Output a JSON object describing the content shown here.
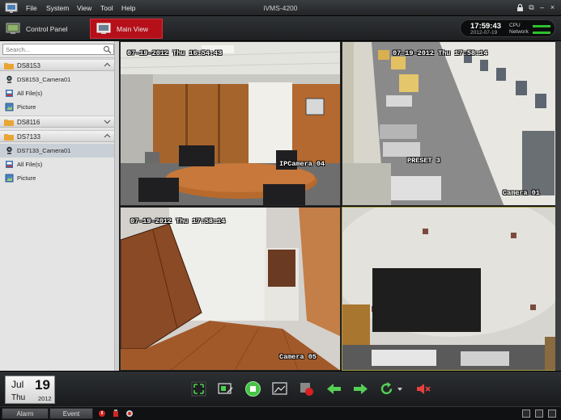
{
  "app": {
    "title": "iVMS-4200"
  },
  "menu": {
    "file": "File",
    "system": "System",
    "view": "View",
    "tool": "Tool",
    "help": "Help"
  },
  "window_controls": {
    "lock": "lock-icon",
    "restore": "⧉",
    "minimize": "–",
    "maximize": "□",
    "close": "×"
  },
  "toolbar": {
    "control_panel": "Control Panel",
    "main_view": "Main View",
    "clock_time": "17:59:43",
    "clock_date": "2012-07-19",
    "cpu_label": "CPU",
    "network_label": "Network",
    "cpu_level": 0.9,
    "network_level": 0.9,
    "accent": "#b5101a",
    "meter_color": "#2ec12e"
  },
  "left_panel": {
    "search_placeholder": "Search...",
    "groups": [
      {
        "label": "DS8153",
        "children": [
          {
            "label": "DS8153_Camera01",
            "icon": "camera-icon"
          },
          {
            "label": "All File(s)",
            "icon": "file-icon"
          },
          {
            "label": "Picture",
            "icon": "picture-icon"
          }
        ]
      },
      {
        "label": "DS8116",
        "children": []
      },
      {
        "label": "DS7133",
        "children": [
          {
            "label": "DS7133_Camera01",
            "icon": "camera-icon",
            "selected": true
          },
          {
            "label": "All File(s)",
            "icon": "file-icon"
          },
          {
            "label": "Picture",
            "icon": "picture-icon"
          }
        ]
      }
    ]
  },
  "views": [
    {
      "timestamp": "07-19-2012 Thu 16:54:43",
      "camera_name": "IPCamera 04"
    },
    {
      "timestamp": "07-19-2012 Thu 17:58:14",
      "camera_name": "Camera 01",
      "preset": "PRESET 3"
    },
    {
      "timestamp": "07-19-2012 Thu 17:58:14",
      "camera_name": "Camera 05"
    },
    {
      "timestamp": "",
      "camera_name": "",
      "selected": true
    }
  ],
  "bottom": {
    "date_month": "Jul",
    "date_day": "19",
    "date_weekday": "Thu",
    "date_year": "2012",
    "controls": [
      "fullscreen-icon",
      "layout-edit-icon",
      "stop-all-icon",
      "capture-icon",
      "record-icon",
      "previous-icon",
      "next-icon",
      "refresh-icon",
      "dropdown-arrow-icon",
      "mute-icon"
    ]
  },
  "status": {
    "alarm_tab": "Alarm",
    "event_tab": "Event"
  }
}
